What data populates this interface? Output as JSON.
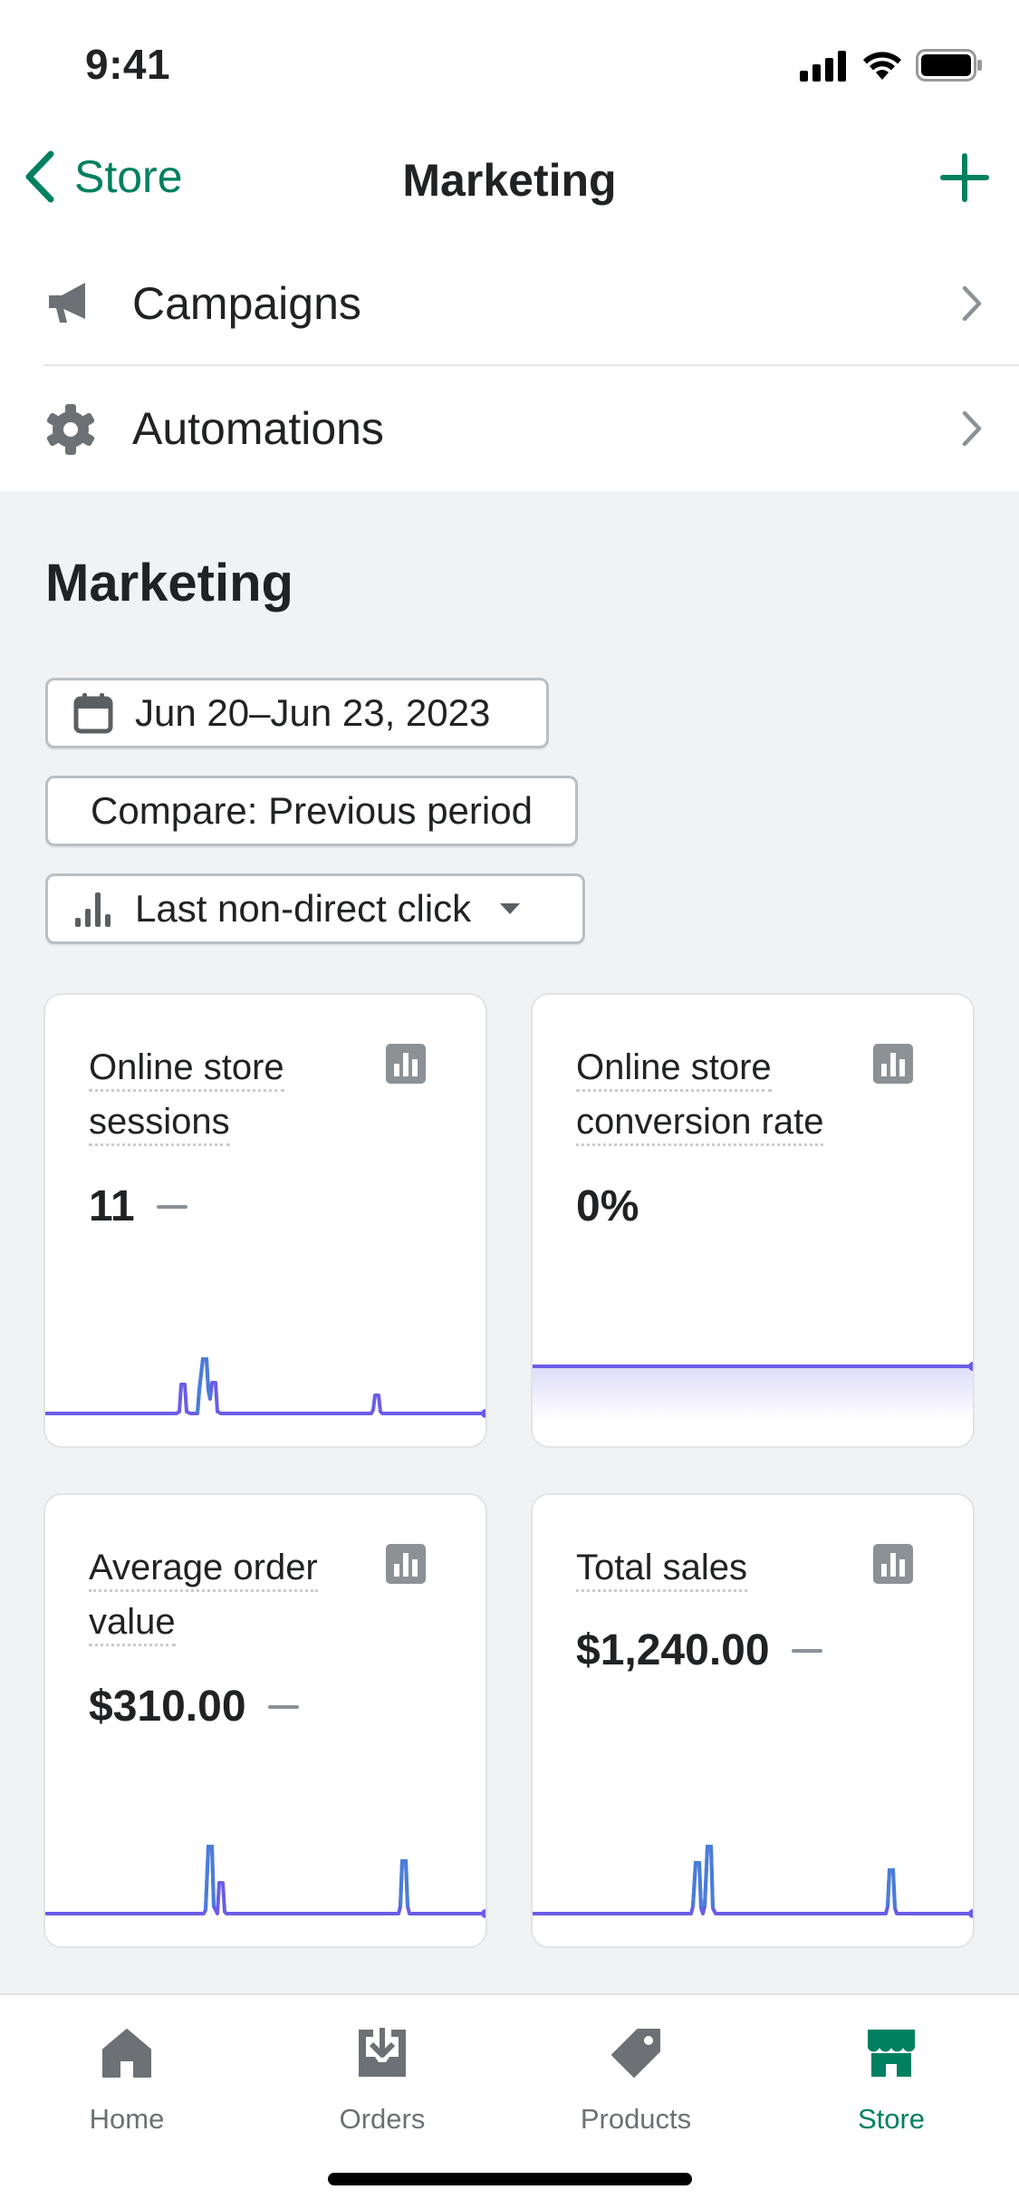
{
  "status_bar": {
    "time": "9:41"
  },
  "nav": {
    "back_label": "Store",
    "title": "Marketing"
  },
  "menu": {
    "items": [
      {
        "label": "Campaigns",
        "icon": "megaphone-icon"
      },
      {
        "label": "Automations",
        "icon": "gear-icon"
      }
    ]
  },
  "section": {
    "title": "Marketing",
    "date_range": "Jun 20–Jun 23, 2023",
    "compare": "Compare: Previous period",
    "attribution": "Last non-direct click"
  },
  "cards": [
    {
      "title_line1": "Online store",
      "title_line2": "sessions",
      "value": "11"
    },
    {
      "title_line1": "Online store",
      "title_line2": "conversion rate",
      "value": "0%"
    },
    {
      "title_line1": "Average order",
      "title_line2": "value",
      "value": "$310.00"
    },
    {
      "title_line1": "Total sales",
      "title_line2": "",
      "value": "$1,240.00"
    }
  ],
  "tabs": [
    {
      "label": "Home",
      "icon": "home-icon"
    },
    {
      "label": "Orders",
      "icon": "orders-inbox-icon"
    },
    {
      "label": "Products",
      "icon": "tag-icon"
    },
    {
      "label": "Store",
      "icon": "store-icon",
      "active": true
    }
  ],
  "colors": {
    "accent": "#008060",
    "sparkline": "#6b5ce7",
    "sparkline_highlight": "#4a7dd8",
    "icon_gray": "#8c9196"
  }
}
